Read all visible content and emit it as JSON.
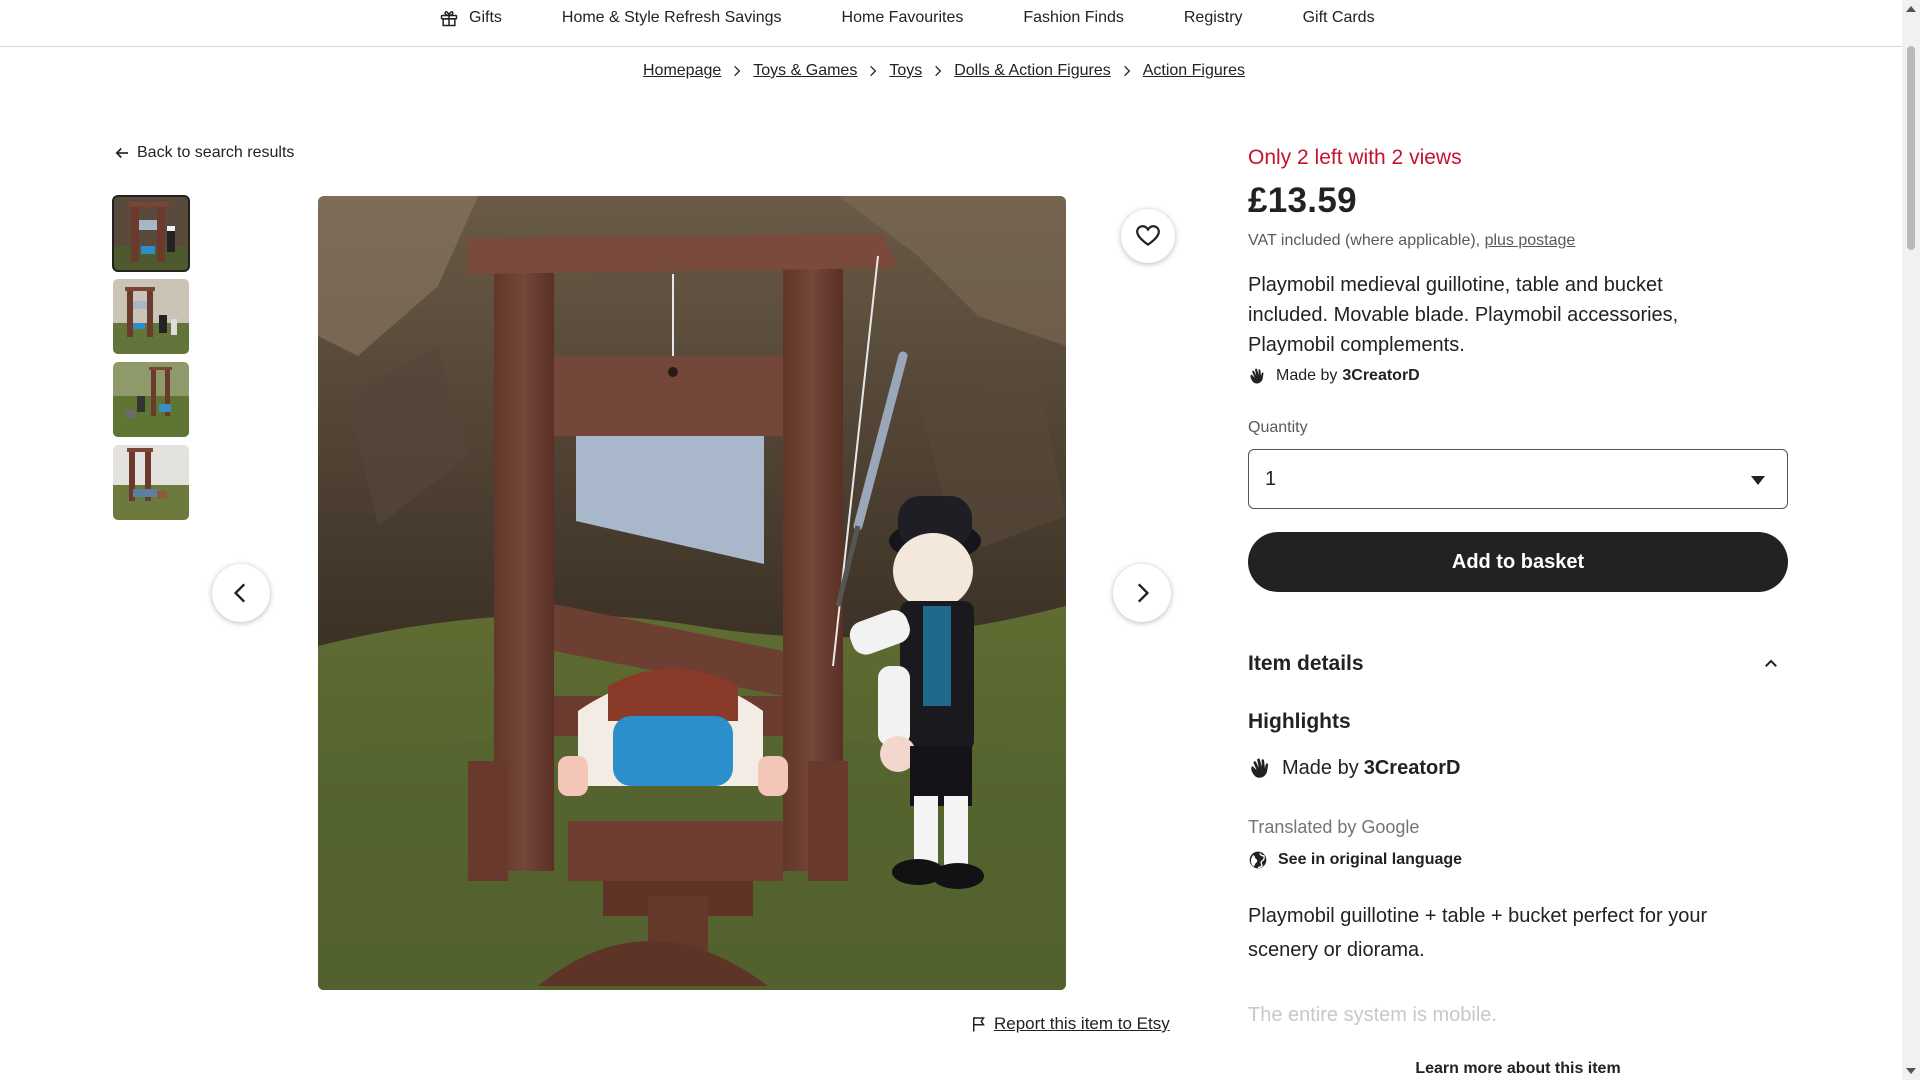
{
  "nav": {
    "items": [
      {
        "label": "Gifts",
        "icon": "gift-icon"
      },
      {
        "label": "Home & Style Refresh Savings"
      },
      {
        "label": "Home Favourites"
      },
      {
        "label": "Fashion Finds"
      },
      {
        "label": "Registry"
      },
      {
        "label": "Gift Cards"
      }
    ]
  },
  "breadcrumb": [
    "Homepage",
    "Toys & Games",
    "Toys",
    "Dolls & Action Figures",
    "Action Figures"
  ],
  "back_link": "Back to search results",
  "gallery": {
    "thumbnail_count": 4,
    "active_index": 0,
    "report_link": "Report this item to Etsy"
  },
  "listing": {
    "stock_note": "Only 2 left with 2 views",
    "price": "£13.59",
    "vat_text": "VAT included (where applicable), ",
    "postage_link": "plus postage",
    "title": "Playmobil medieval guillotine, table and bucket included. Movable blade. Playmobil accessories, Playmobil complements.",
    "made_by_prefix": "Made by",
    "shop_name": "3CreatorD",
    "quantity_label": "Quantity",
    "quantity_value": "1",
    "add_to_basket": "Add to basket"
  },
  "details": {
    "header": "Item details",
    "highlights": "Highlights",
    "translated_note": "Translated by Google",
    "original_language_link": "See in original language",
    "description_1": "Playmobil guillotine + table + bucket perfect for your scenery or diorama.",
    "description_2": "The entire system is mobile.",
    "learn_more": "Learn more about this item"
  },
  "colors": {
    "stock_alert": "#c4122f",
    "button_dark": "#222222",
    "text_muted": "#595959"
  }
}
